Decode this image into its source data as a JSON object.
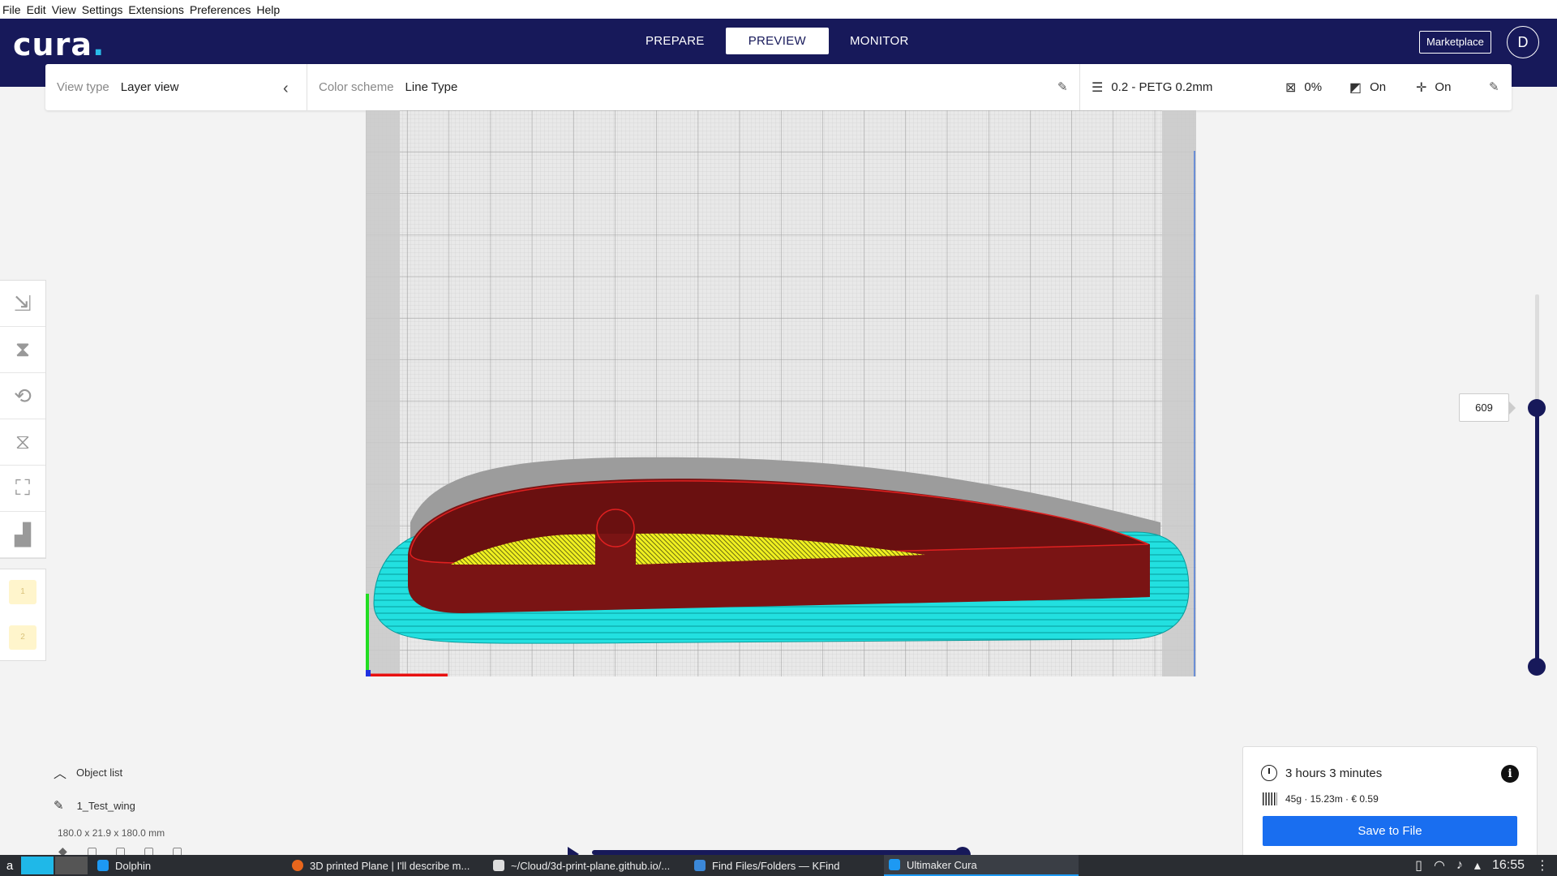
{
  "menubar": {
    "items": [
      "File",
      "Edit",
      "View",
      "Settings",
      "Extensions",
      "Preferences",
      "Help"
    ]
  },
  "header": {
    "logo": "cura",
    "stages": [
      "PREPARE",
      "PREVIEW",
      "MONITOR"
    ],
    "active_stage": "PREVIEW",
    "marketplace_label": "Marketplace",
    "account_initial": "D"
  },
  "view_options": {
    "view_type_label": "View type",
    "view_type_value": "Layer view",
    "color_scheme_label": "Color scheme",
    "color_scheme_value": "Line Type",
    "profile": "0.2 - PETG 0.2mm",
    "infill": "0%",
    "support": "On",
    "adhesion": "On"
  },
  "layer_slider": {
    "current_layer": "609",
    "max_level_fraction": 0.3
  },
  "object_list": {
    "header": "Object list",
    "object_name": "1_Test_wing",
    "dimensions": "180.0 x 21.9 x 180.0 mm"
  },
  "print_info": {
    "time": "3 hours 3 minutes",
    "material": "45g · 15.23m · € 0.59",
    "save_label": "Save to File"
  },
  "taskbar": {
    "tasks": [
      {
        "label": "Dolphin",
        "color": "#1d99f3",
        "active": false
      },
      {
        "label": "3D printed Plane | I'll describe m...",
        "color": "#e8661c",
        "active": false
      },
      {
        "label": "~/Cloud/3d-print-plane.github.io/...",
        "color": "#dddddd",
        "active": false
      },
      {
        "label": "Find Files/Folders — KFind",
        "color": "#3b88d8",
        "active": false
      },
      {
        "label": "Ultimaker Cura",
        "color": "#1d99f3",
        "active": true
      }
    ],
    "clock": "16:55"
  },
  "colors": {
    "header_bg": "#17195a",
    "accent": "#196ef0",
    "wall": "#7a1414",
    "infill": "#e8e817",
    "skirt": "#22e0e0"
  }
}
